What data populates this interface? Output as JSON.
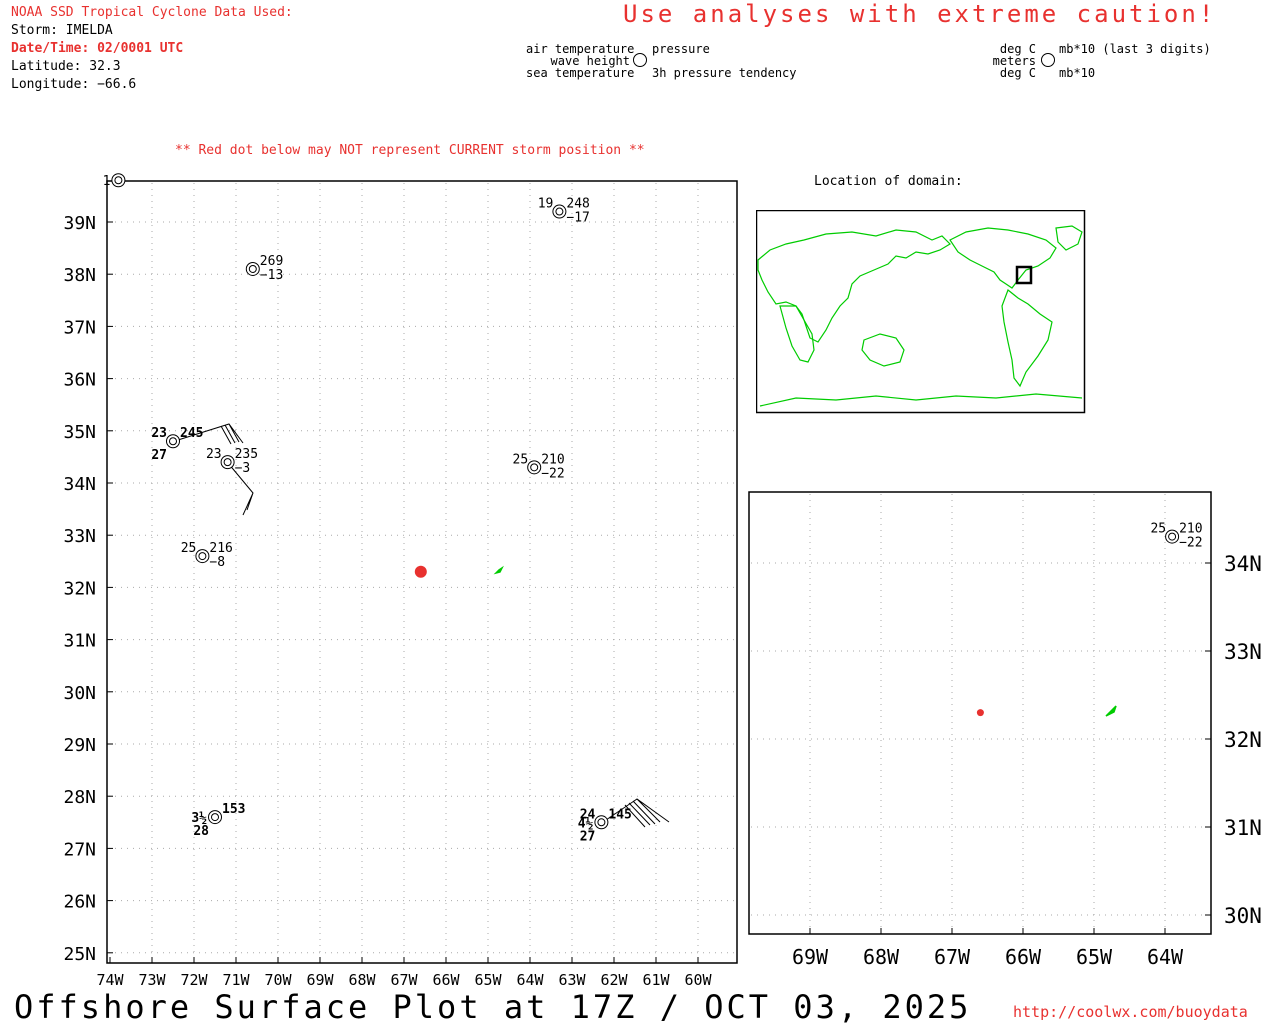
{
  "header": {
    "source_title": "NOAA SSD Tropical Cyclone Data Used:",
    "storm_line": "Storm: IMELDA",
    "datetime_line": "Date/Time: 02/0001 UTC",
    "latitude_line": "Latitude: 32.3",
    "longitude_line": "Longitude: −66.6",
    "caution": "Use analyses with extreme caution!",
    "red_dot_note": "** Red dot below may NOT represent CURRENT storm position **"
  },
  "legend": {
    "left": [
      "air temperature",
      "wave height",
      "sea temperature"
    ],
    "right": [
      "pressure",
      "",
      "3h pressure tendency"
    ],
    "units_left": [
      "deg C",
      "meters",
      "deg C"
    ],
    "units_right": [
      "mb*10 (last 3 digits)",
      "",
      "mb*10"
    ]
  },
  "inset": {
    "title": "Location of domain:"
  },
  "footer": {
    "title": "Offshore Surface Plot at 17Z / OCT 03, 2025",
    "url": "http://coolwx.com/buoydata"
  },
  "main_map": {
    "lat_labels": [
      "39N",
      "38N",
      "37N",
      "36N",
      "35N",
      "34N",
      "33N",
      "32N",
      "31N",
      "30N",
      "29N",
      "28N",
      "27N",
      "26N",
      "25N"
    ],
    "lon_labels": [
      "74W",
      "73W",
      "72W",
      "71W",
      "70W",
      "69W",
      "68W",
      "67W",
      "66W",
      "65W",
      "64W",
      "63W",
      "62W",
      "61W",
      "60W"
    ],
    "storm_position": {
      "lat": 32.3,
      "lon": -66.6
    },
    "stations": [
      {
        "lat": 39.8,
        "lon": -73.8,
        "pres": "",
        "tend": "",
        "air": "",
        "wave": "1",
        "sea": ""
      },
      {
        "lat": 39.2,
        "lon": -63.3,
        "pres": "248",
        "tend": "−17",
        "air": "19",
        "wave": "",
        "sea": ""
      },
      {
        "lat": 38.1,
        "lon": -70.6,
        "pres": "269",
        "tend": "−13",
        "air": "",
        "wave": "",
        "sea": ""
      },
      {
        "lat": 34.8,
        "lon": -72.5,
        "pres": "245",
        "tend": "",
        "air": "23",
        "wave": "",
        "sea": "27"
      },
      {
        "lat": 34.4,
        "lon": -71.2,
        "pres": "235",
        "tend": "−3",
        "air": "23",
        "wave": "",
        "sea": ""
      },
      {
        "lat": 34.3,
        "lon": -63.9,
        "pres": "210",
        "tend": "−22",
        "air": "25",
        "wave": "",
        "sea": ""
      },
      {
        "lat": 32.6,
        "lon": -71.8,
        "pres": "216",
        "tend": "−8",
        "air": "25",
        "wave": "",
        "sea": ""
      },
      {
        "lat": 27.6,
        "lon": -71.5,
        "pres": "153",
        "tend": "",
        "air": "",
        "wave": "3½",
        "sea": "28"
      },
      {
        "lat": 27.5,
        "lon": -62.3,
        "pres": "145",
        "tend": "",
        "air": "24",
        "wave": "4½",
        "sea": "27"
      }
    ]
  },
  "zoom_map": {
    "lat_labels": [
      "34N",
      "33N",
      "32N",
      "31N",
      "30N"
    ],
    "lon_labels": [
      "69W",
      "68W",
      "67W",
      "66W",
      "65W",
      "64W"
    ],
    "storm_position": {
      "lat": 32.3,
      "lon": -66.6
    },
    "stations": [
      {
        "lat": 34.3,
        "lon": -63.9,
        "pres": "210",
        "tend": "−22",
        "air": "25"
      }
    ]
  },
  "colors": {
    "title_red": "#e8312f",
    "storm_dot": "#e8312f",
    "land": "#00cc00",
    "grid": "#aaaaaa"
  }
}
